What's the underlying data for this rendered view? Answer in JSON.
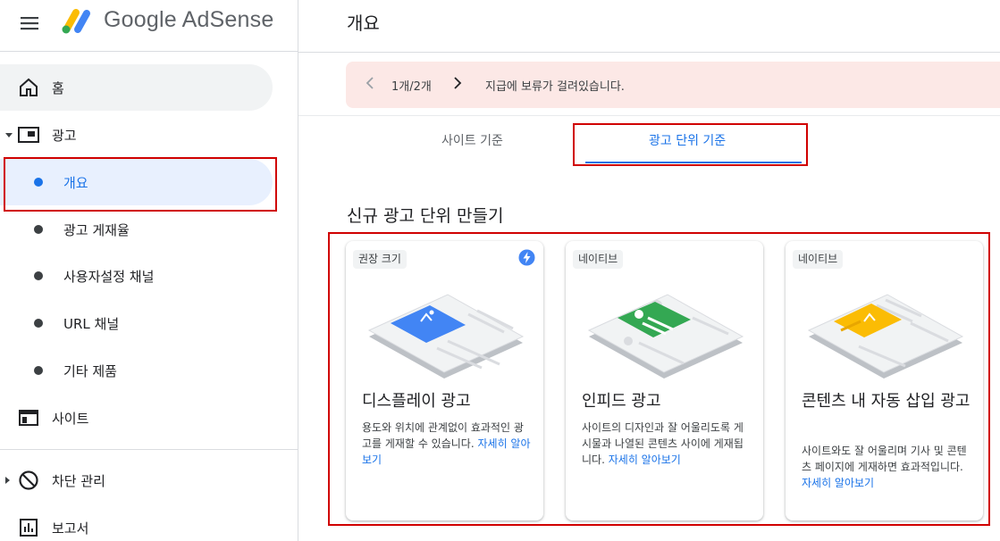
{
  "brand": {
    "name": "Google AdSense"
  },
  "header": {
    "title": "개요"
  },
  "sidebar": {
    "items": [
      {
        "label": "홈"
      },
      {
        "label": "광고"
      },
      {
        "label": "개요"
      },
      {
        "label": "광고 게재율"
      },
      {
        "label": "사용자설정 채널"
      },
      {
        "label": "URL 채널"
      },
      {
        "label": "기타 제품"
      },
      {
        "label": "사이트"
      },
      {
        "label": "차단 관리"
      },
      {
        "label": "보고서"
      }
    ]
  },
  "alert": {
    "count": "1개/2개",
    "message": "지급에 보류가 걸려있습니다."
  },
  "tabs": [
    {
      "label": "사이트 기준"
    },
    {
      "label": "광고 단위 기준"
    }
  ],
  "section": {
    "title": "신규 광고 단위 만들기"
  },
  "cards": [
    {
      "chip": "권장 크기",
      "title": "디스플레이 광고",
      "desc": "용도와 위치에 관계없이 효과적인 광고를 게재할 수 있습니다.",
      "link": "자세히 알아보기"
    },
    {
      "chip": "네이티브",
      "title": "인피드 광고",
      "desc": "사이트의 디자인과 잘 어울리도록 게시물과 나열된 콘텐츠 사이에 게재됩니다.",
      "link": "자세히 알아보기"
    },
    {
      "chip": "네이티브",
      "title": "콘텐츠 내 자동 삽입 광고",
      "desc": "사이트와도 잘 어울리며 기사 및 콘텐츠 페이지에 게재하면 효과적입니다.",
      "link": "자세히 알아보기"
    }
  ],
  "colors": {
    "accent": "#1a73e8",
    "alert_bg": "#fce8e6",
    "active_bg": "#e8f0fe",
    "highlight": "#d00000"
  },
  "icons": [
    "menu-icon",
    "adsense-logo",
    "home-icon",
    "ads-icon",
    "sites-icon",
    "block-icon",
    "reports-icon",
    "bolt-icon"
  ]
}
